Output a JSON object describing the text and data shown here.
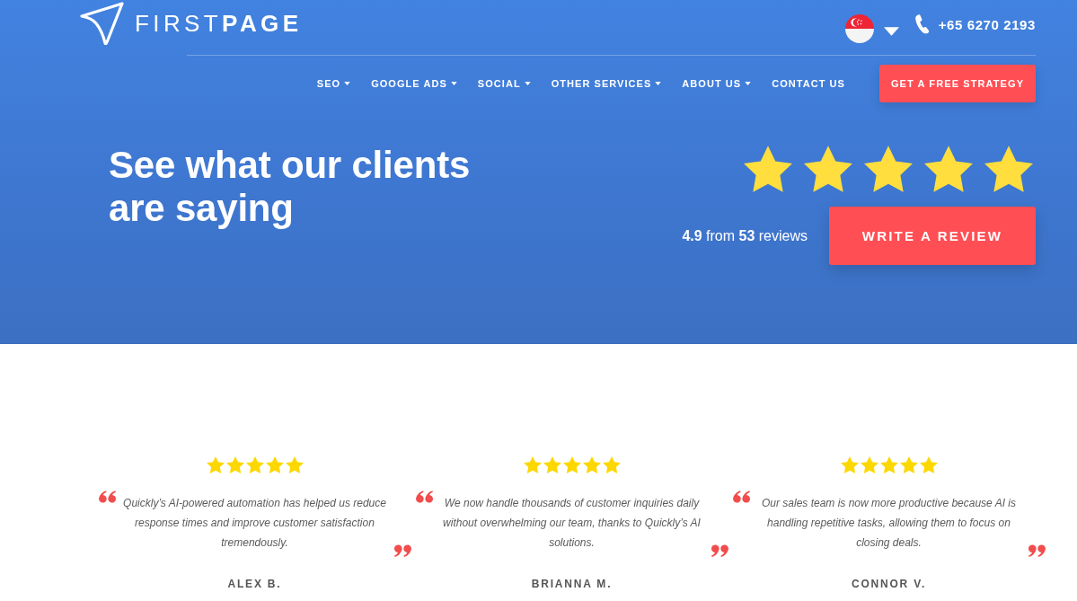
{
  "header": {
    "logo": "FIRST**PAGE**",
    "phone": "+65 6270 2193"
  },
  "nav": {
    "items": [
      {
        "label": "SEO",
        "dropdown": true
      },
      {
        "label": "GOOGLE ADS",
        "dropdown": true
      },
      {
        "label": "SOCIAL",
        "dropdown": true
      },
      {
        "label": "OTHER SERVICES",
        "dropdown": true
      },
      {
        "label": "ABOUT US",
        "dropdown": true
      },
      {
        "label": "CONTACT US",
        "dropdown": false
      }
    ],
    "cta": "GET A FREE STRATEGY"
  },
  "hero": {
    "title": "See what our clients are saying",
    "stars": 5,
    "rating_text": "**4.9** from **53** reviews",
    "button": "WRITE A REVIEW"
  },
  "testimonials": [
    {
      "stars": 5,
      "quote": "Quickly’s AI-powered automation has helped us reduce response times and improve customer satisfaction tremendously.",
      "name": "ALEX B."
    },
    {
      "stars": 5,
      "quote": "We now handle thousands of customer inquiries daily without overwhelming our team, thanks to Quickly’s AI solutions.",
      "name": "BRIANNA M."
    },
    {
      "stars": 5,
      "quote": "Our sales team is now more productive because AI is handling repetitive tasks, allowing them to focus on closing deals.",
      "name": "CONNOR V."
    }
  ]
}
